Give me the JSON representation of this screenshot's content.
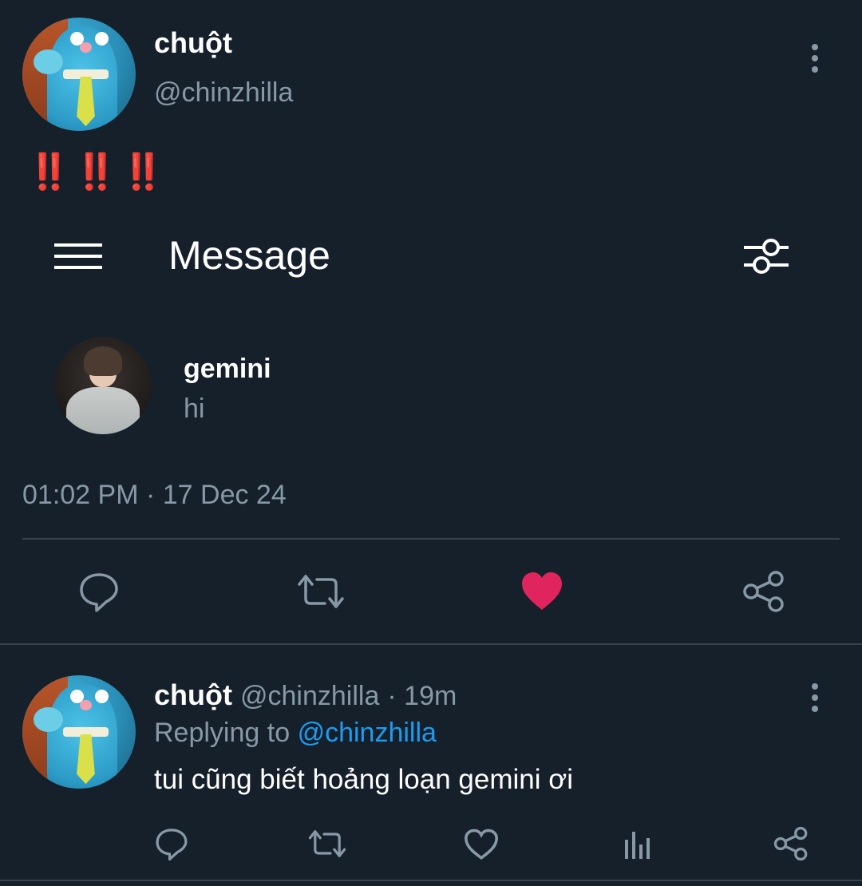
{
  "tweet": {
    "display_name": "chuột",
    "handle": "@chinzhilla",
    "avatar_icon": "blue-muppet-avatar",
    "text": "‼️‼️‼️",
    "timestamp": "01:02 PM · 17 Dec 24",
    "liked": true,
    "like_color": "#e0245e"
  },
  "embedded": {
    "header_title": "Message",
    "menu_icon": "hamburger-menu-icon",
    "filter_icon": "sliders-icon",
    "chat_name": "gemini",
    "chat_preview": "hi"
  },
  "reply": {
    "display_name": "chuột",
    "handle": "@chinzhilla",
    "age": "· 19m",
    "replying_prefix": "Replying to",
    "replying_to": "@chinzhilla",
    "text": "tui cũng biết hoảng loạn gemini ơi"
  },
  "colors": {
    "background": "#15202b",
    "muted": "#8899a6",
    "link": "#1d9bf0",
    "divider": "#38444d"
  }
}
